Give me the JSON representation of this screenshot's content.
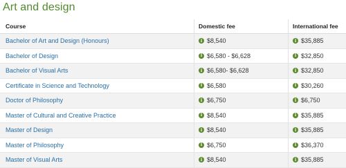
{
  "title": "Art and design",
  "columns": {
    "course": "Course",
    "domestic": "Domestic fee",
    "international": "International fee"
  },
  "info_icon_glyph": "i",
  "colors": {
    "title": "#4f8a2c",
    "link": "#2a6fa8",
    "info_icon": "#5e8a2e"
  },
  "rows": [
    {
      "course": "Bachelor of Art and Design (Honours)",
      "domestic": "$8,540",
      "international": "$35,885"
    },
    {
      "course": "Bachelor of Design",
      "domestic": "$6,580 - $6,628",
      "international": "$32,850"
    },
    {
      "course": "Bachelor of Visual Arts",
      "domestic": "$6,580- $6,628",
      "international": "$32,850"
    },
    {
      "course": "Certificate in Science and Technology",
      "domestic": "$6,580",
      "international": "$30,260"
    },
    {
      "course": "Doctor of Philosophy",
      "domestic": "$6,750",
      "international": "$6,750"
    },
    {
      "course": "Master of Cultural and Creative Practice",
      "domestic": "$8,540",
      "international": "$35,885"
    },
    {
      "course": "Master of Design",
      "domestic": "$8,540",
      "international": "$35,885"
    },
    {
      "course": "Master of Philosophy",
      "domestic": "$6,750",
      "international": "$36,370"
    },
    {
      "course": "Master of Visual Arts",
      "domestic": "$8,540",
      "international": "$35,885"
    }
  ]
}
